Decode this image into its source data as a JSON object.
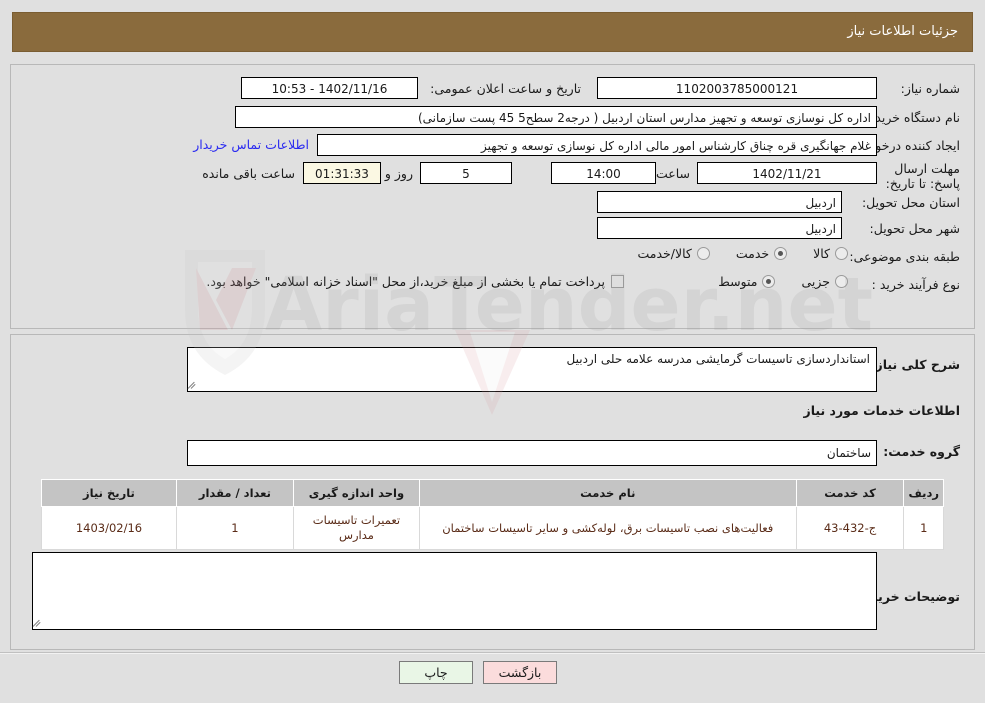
{
  "header": {
    "title": "جزئیات اطلاعات نیاز"
  },
  "form": {
    "need_number_label": "شماره نیاز:",
    "need_number_value": "1102003785000121",
    "announce_datetime_label": "تاریخ و ساعت اعلان عمومی:",
    "announce_datetime_value": "1402/11/16 - 10:53",
    "buyer_org_label": "نام دستگاه خریدار:",
    "buyer_org_value": "اداره کل نوسازی   توسعه و تجهیز مدارس استان اردبیل ( درجه2  سطح5  45 پست سازمانی)",
    "creator_label": "ایجاد کننده درخواست:",
    "creator_value": "غلام جهانگیری قره چناق کارشناس امور مالی اداره کل نوسازی   توسعه و تجهیز",
    "contact_link": "اطلاعات تماس خریدار",
    "deadline_label": "مهلت ارسال پاسخ: تا تاریخ:",
    "deadline_date": "1402/11/21",
    "hour_label": "ساعت",
    "deadline_time": "14:00",
    "days_value": "5",
    "days_and_label": "روز و",
    "countdown_value": "01:31:33",
    "remaining_label": "ساعت باقی مانده",
    "province_label": "استان محل تحویل:",
    "province_value": "اردبیل",
    "city_label": "شهر محل تحویل:",
    "city_value": "اردبیل",
    "category_label": "طبقه بندی موضوعی:",
    "category_options": [
      {
        "label": "کالا",
        "selected": false
      },
      {
        "label": "خدمت",
        "selected": true
      },
      {
        "label": "کالا/خدمت",
        "selected": false
      }
    ],
    "process_label": "نوع فرآیند خرید :",
    "process_options": [
      {
        "label": "جزیی",
        "selected": false
      },
      {
        "label": "متوسط",
        "selected": true
      }
    ],
    "treasury_checkbox_checked": false,
    "treasury_text": "پرداخت تمام یا بخشی از مبلغ خرید،از محل \"اسناد خزانه اسلامی\" خواهد بود."
  },
  "details": {
    "general_desc_label": "شرح کلی نیاز:",
    "general_desc_value": "استانداردسازی تاسیسات گرمایشی مدرسه علامه حلی اردبیل",
    "services_section_title": "اطلاعات خدمات مورد نیاز",
    "service_group_label": "گروه خدمت:",
    "service_group_value": "ساختمان",
    "buyer_notes_label": "توضیحات خریدار:",
    "buyer_notes_value": ""
  },
  "table": {
    "columns": [
      "ردیف",
      "کد خدمت",
      "نام خدمت",
      "واحد اندازه گیری",
      "تعداد / مقدار",
      "تاریخ نیاز"
    ],
    "rows": [
      {
        "row": "1",
        "code": "ج-432-43",
        "name": "فعالیت‌های نصب تاسیسات برق، لوله‌کشی و سایر تاسیسات ساختمان",
        "unit": "تعمیرات تاسیسات مدارس",
        "qty": "1",
        "date": "1403/02/16"
      }
    ]
  },
  "footer": {
    "print_label": "چاپ",
    "back_label": "بازگشت"
  },
  "colors": {
    "header_bg": "#8a6b3d",
    "page_bg": "#e0e0e0",
    "link": "#2a2af0",
    "countdown_bg": "#fbf8e3",
    "print_bg": "#e9f6e6",
    "back_bg": "#fbdcdc",
    "table_header_bg": "#c4c4c4",
    "table_text": "#5a2b17"
  },
  "watermark": {
    "text": "AriaTender.net"
  }
}
